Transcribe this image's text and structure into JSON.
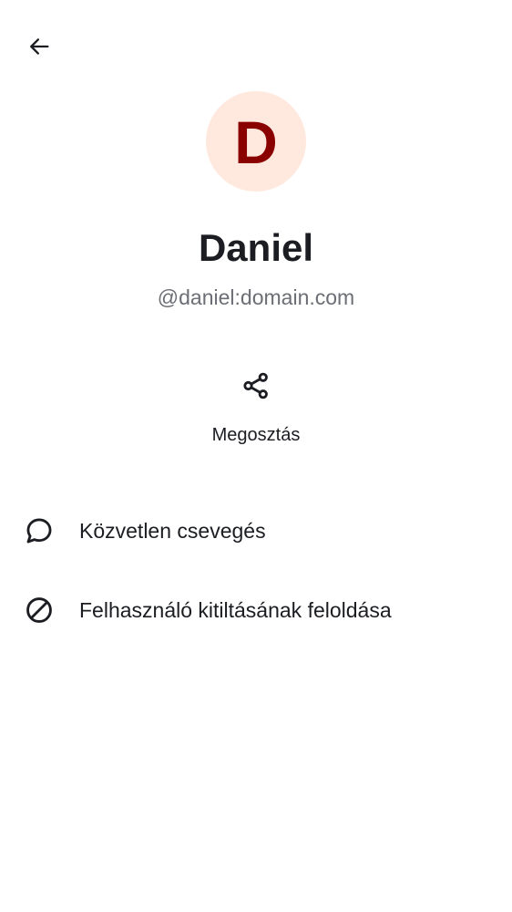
{
  "header": {
    "back_icon": "arrow-left-icon"
  },
  "profile": {
    "avatar_initial": "D",
    "avatar_bg": "#ffe9df",
    "avatar_fg": "#8a0000",
    "display_name": "Daniel",
    "user_id": "@daniel:domain.com"
  },
  "actions": {
    "share": {
      "icon": "share-icon",
      "label": "Megosztás"
    }
  },
  "list": {
    "items": [
      {
        "icon": "chat-bubble-icon",
        "label": "Közvetlen csevegés"
      },
      {
        "icon": "block-icon",
        "label": "Felhasználó kitiltásának feloldása"
      }
    ]
  }
}
